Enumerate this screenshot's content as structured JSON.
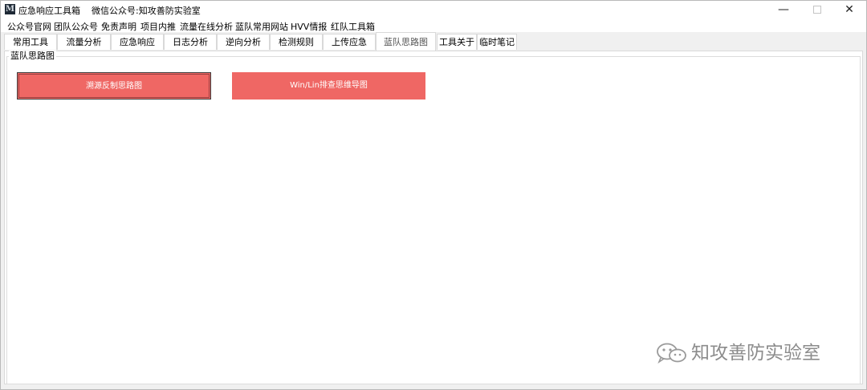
{
  "window": {
    "icon_glyph": "M",
    "title": "应急响应工具箱    微信公众号:知攻善防实验室",
    "controls": {
      "minimize": "—",
      "close": "✕"
    }
  },
  "menubar": {
    "items": [
      "公众号官网",
      "团队公众号",
      "免责声明",
      "项目内推",
      "流量在线分析",
      "蓝队常用网站",
      "HVV情报",
      "红队工具箱"
    ]
  },
  "tabs": {
    "items": [
      "常用工具",
      "流量分析",
      "应急响应",
      "日志分析",
      "逆向分析",
      "检测规则",
      "上传应急",
      "蓝队思路图",
      "工具关于",
      "临时笔记"
    ],
    "active": "蓝队思路图"
  },
  "group": {
    "label": "蓝队思路图"
  },
  "buttons": {
    "trace_map": "溯源反制思路图",
    "winlin_map": "Win/Lin排查思维导图"
  },
  "watermark": {
    "text": "知攻善防实验室",
    "icon": "wechat-icon"
  },
  "colors": {
    "button_red": "#ef6764",
    "active_tab_text": "#555555"
  }
}
